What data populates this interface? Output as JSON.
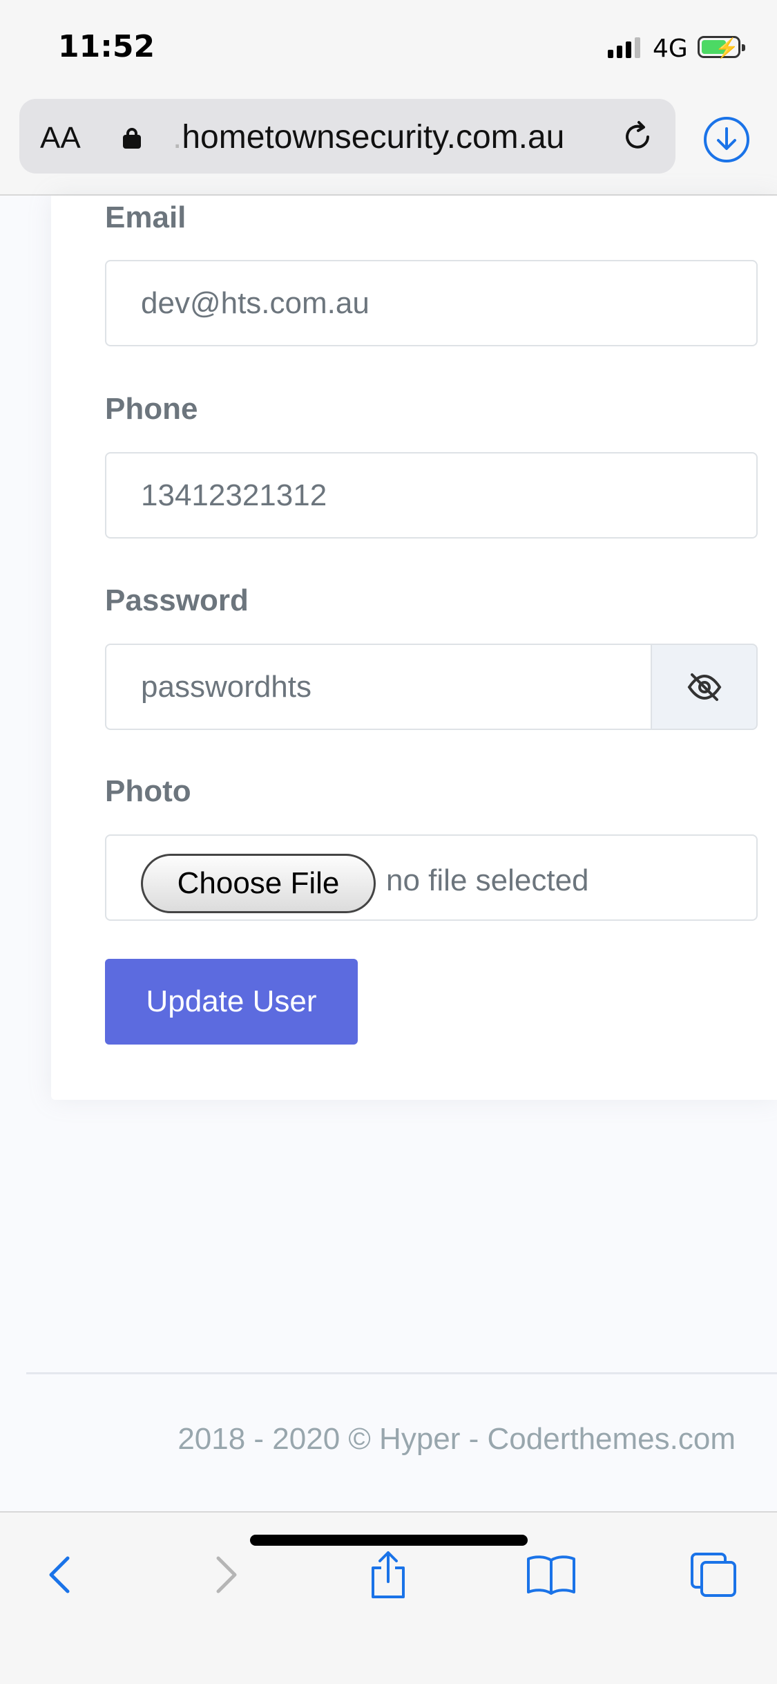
{
  "status_bar": {
    "time": "11:52",
    "network": "4G",
    "icons": [
      "cellular-signal-icon",
      "battery-charging-icon"
    ]
  },
  "browser": {
    "text_size_label": "AA",
    "url_prefix": ".",
    "url": "hometownsecurity.com.au",
    "icons": [
      "lock-icon",
      "reload-icon",
      "download-icon"
    ]
  },
  "form": {
    "email": {
      "label": "Email",
      "value": "dev@hts.com.au"
    },
    "phone": {
      "label": "Phone",
      "value": "13412321312"
    },
    "password": {
      "label": "Password",
      "value": "passwordhts",
      "toggle_icon": "eye-slash-icon"
    },
    "photo": {
      "label": "Photo",
      "button_label": "Choose File",
      "status": "no file selected"
    },
    "submit_label": "Update User"
  },
  "footer": {
    "text": "2018 - 2020 © Hyper - Coderthemes.com"
  },
  "toolbar": {
    "icons": [
      "back-icon",
      "forward-icon",
      "share-icon",
      "bookmarks-icon",
      "tabs-icon"
    ]
  },
  "colors": {
    "primary": "#5c6bdf",
    "safari_blue": "#1a73e8",
    "muted_text": "#6c757d"
  }
}
